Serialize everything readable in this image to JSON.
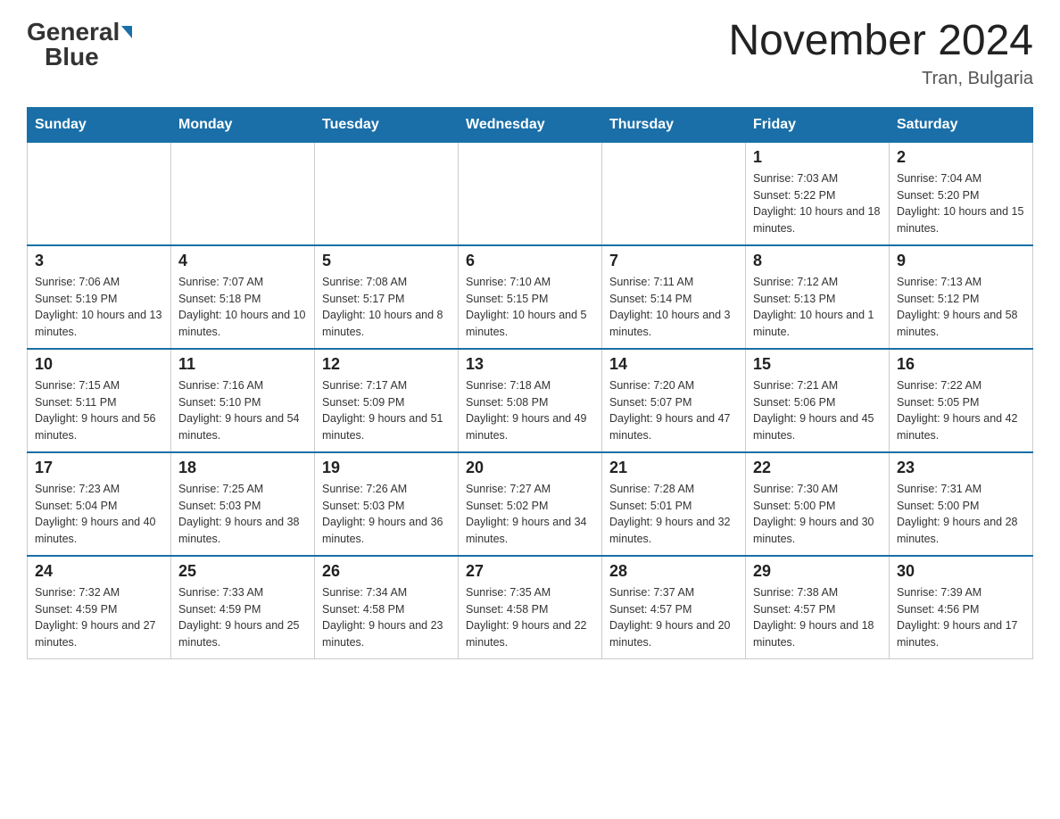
{
  "header": {
    "logo_general": "General",
    "logo_blue": "Blue",
    "month_title": "November 2024",
    "location": "Tran, Bulgaria"
  },
  "days_of_week": [
    "Sunday",
    "Monday",
    "Tuesday",
    "Wednesday",
    "Thursday",
    "Friday",
    "Saturday"
  ],
  "weeks": [
    {
      "days": [
        {
          "number": "",
          "info": ""
        },
        {
          "number": "",
          "info": ""
        },
        {
          "number": "",
          "info": ""
        },
        {
          "number": "",
          "info": ""
        },
        {
          "number": "",
          "info": ""
        },
        {
          "number": "1",
          "info": "Sunrise: 7:03 AM\nSunset: 5:22 PM\nDaylight: 10 hours and 18 minutes."
        },
        {
          "number": "2",
          "info": "Sunrise: 7:04 AM\nSunset: 5:20 PM\nDaylight: 10 hours and 15 minutes."
        }
      ]
    },
    {
      "days": [
        {
          "number": "3",
          "info": "Sunrise: 7:06 AM\nSunset: 5:19 PM\nDaylight: 10 hours and 13 minutes."
        },
        {
          "number": "4",
          "info": "Sunrise: 7:07 AM\nSunset: 5:18 PM\nDaylight: 10 hours and 10 minutes."
        },
        {
          "number": "5",
          "info": "Sunrise: 7:08 AM\nSunset: 5:17 PM\nDaylight: 10 hours and 8 minutes."
        },
        {
          "number": "6",
          "info": "Sunrise: 7:10 AM\nSunset: 5:15 PM\nDaylight: 10 hours and 5 minutes."
        },
        {
          "number": "7",
          "info": "Sunrise: 7:11 AM\nSunset: 5:14 PM\nDaylight: 10 hours and 3 minutes."
        },
        {
          "number": "8",
          "info": "Sunrise: 7:12 AM\nSunset: 5:13 PM\nDaylight: 10 hours and 1 minute."
        },
        {
          "number": "9",
          "info": "Sunrise: 7:13 AM\nSunset: 5:12 PM\nDaylight: 9 hours and 58 minutes."
        }
      ]
    },
    {
      "days": [
        {
          "number": "10",
          "info": "Sunrise: 7:15 AM\nSunset: 5:11 PM\nDaylight: 9 hours and 56 minutes."
        },
        {
          "number": "11",
          "info": "Sunrise: 7:16 AM\nSunset: 5:10 PM\nDaylight: 9 hours and 54 minutes."
        },
        {
          "number": "12",
          "info": "Sunrise: 7:17 AM\nSunset: 5:09 PM\nDaylight: 9 hours and 51 minutes."
        },
        {
          "number": "13",
          "info": "Sunrise: 7:18 AM\nSunset: 5:08 PM\nDaylight: 9 hours and 49 minutes."
        },
        {
          "number": "14",
          "info": "Sunrise: 7:20 AM\nSunset: 5:07 PM\nDaylight: 9 hours and 47 minutes."
        },
        {
          "number": "15",
          "info": "Sunrise: 7:21 AM\nSunset: 5:06 PM\nDaylight: 9 hours and 45 minutes."
        },
        {
          "number": "16",
          "info": "Sunrise: 7:22 AM\nSunset: 5:05 PM\nDaylight: 9 hours and 42 minutes."
        }
      ]
    },
    {
      "days": [
        {
          "number": "17",
          "info": "Sunrise: 7:23 AM\nSunset: 5:04 PM\nDaylight: 9 hours and 40 minutes."
        },
        {
          "number": "18",
          "info": "Sunrise: 7:25 AM\nSunset: 5:03 PM\nDaylight: 9 hours and 38 minutes."
        },
        {
          "number": "19",
          "info": "Sunrise: 7:26 AM\nSunset: 5:03 PM\nDaylight: 9 hours and 36 minutes."
        },
        {
          "number": "20",
          "info": "Sunrise: 7:27 AM\nSunset: 5:02 PM\nDaylight: 9 hours and 34 minutes."
        },
        {
          "number": "21",
          "info": "Sunrise: 7:28 AM\nSunset: 5:01 PM\nDaylight: 9 hours and 32 minutes."
        },
        {
          "number": "22",
          "info": "Sunrise: 7:30 AM\nSunset: 5:00 PM\nDaylight: 9 hours and 30 minutes."
        },
        {
          "number": "23",
          "info": "Sunrise: 7:31 AM\nSunset: 5:00 PM\nDaylight: 9 hours and 28 minutes."
        }
      ]
    },
    {
      "days": [
        {
          "number": "24",
          "info": "Sunrise: 7:32 AM\nSunset: 4:59 PM\nDaylight: 9 hours and 27 minutes."
        },
        {
          "number": "25",
          "info": "Sunrise: 7:33 AM\nSunset: 4:59 PM\nDaylight: 9 hours and 25 minutes."
        },
        {
          "number": "26",
          "info": "Sunrise: 7:34 AM\nSunset: 4:58 PM\nDaylight: 9 hours and 23 minutes."
        },
        {
          "number": "27",
          "info": "Sunrise: 7:35 AM\nSunset: 4:58 PM\nDaylight: 9 hours and 22 minutes."
        },
        {
          "number": "28",
          "info": "Sunrise: 7:37 AM\nSunset: 4:57 PM\nDaylight: 9 hours and 20 minutes."
        },
        {
          "number": "29",
          "info": "Sunrise: 7:38 AM\nSunset: 4:57 PM\nDaylight: 9 hours and 18 minutes."
        },
        {
          "number": "30",
          "info": "Sunrise: 7:39 AM\nSunset: 4:56 PM\nDaylight: 9 hours and 17 minutes."
        }
      ]
    }
  ]
}
